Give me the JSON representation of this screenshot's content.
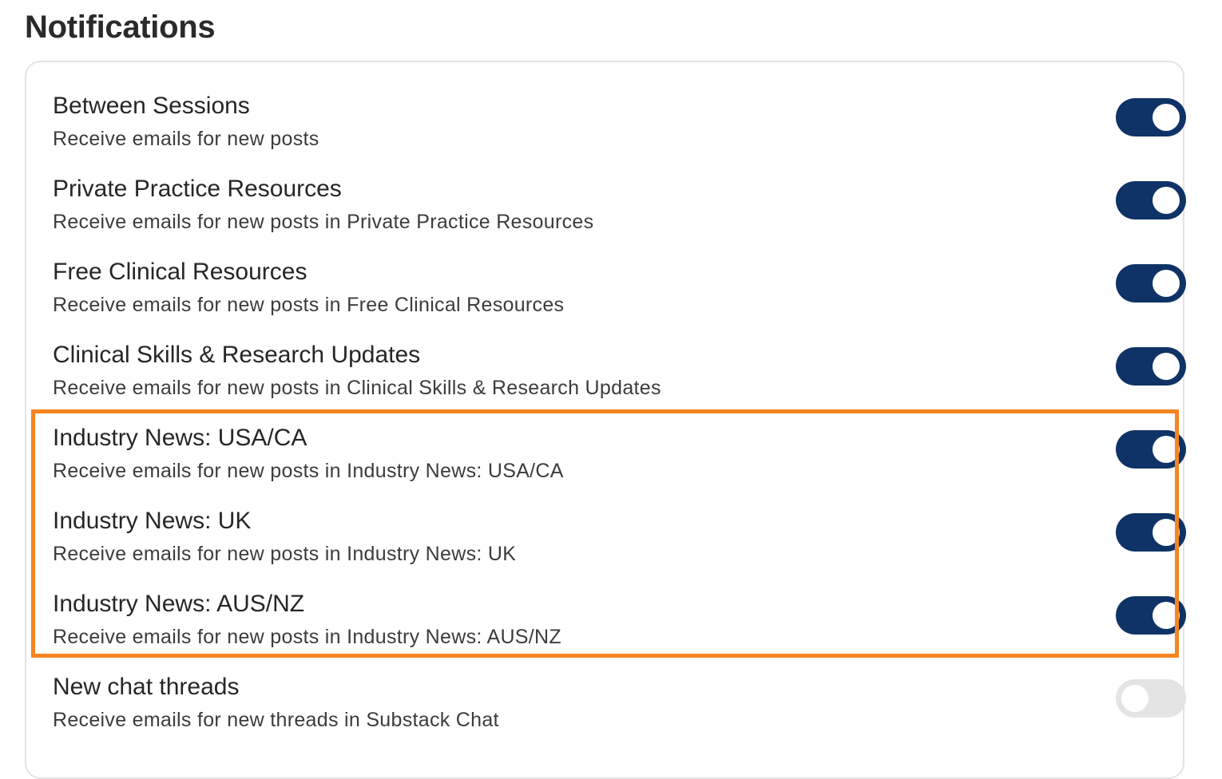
{
  "page": {
    "title": "Notifications"
  },
  "notifications": [
    {
      "title": "Between Sessions",
      "description": "Receive emails for new posts",
      "enabled": true
    },
    {
      "title": "Private Practice Resources",
      "description": "Receive emails for new posts in Private Practice Resources",
      "enabled": true
    },
    {
      "title": "Free Clinical Resources",
      "description": "Receive emails for new posts in Free Clinical Resources",
      "enabled": true
    },
    {
      "title": "Clinical Skills & Research Updates",
      "description": "Receive emails for new posts in Clinical Skills & Research Updates",
      "enabled": true
    },
    {
      "title": "Industry News: USA/CA",
      "description": "Receive emails for new posts in Industry News: USA/CA",
      "enabled": true
    },
    {
      "title": "Industry News: UK",
      "description": "Receive emails for new posts in Industry News: UK",
      "enabled": true
    },
    {
      "title": "Industry News: AUS/NZ",
      "description": "Receive emails for new posts in Industry News: AUS/NZ",
      "enabled": true
    },
    {
      "title": "New chat threads",
      "description": "Receive emails for new threads in Substack Chat",
      "enabled": false
    }
  ],
  "colors": {
    "toggle_on": "#0f3366",
    "toggle_off": "#e4e4e4",
    "highlight": "#f6841f"
  }
}
